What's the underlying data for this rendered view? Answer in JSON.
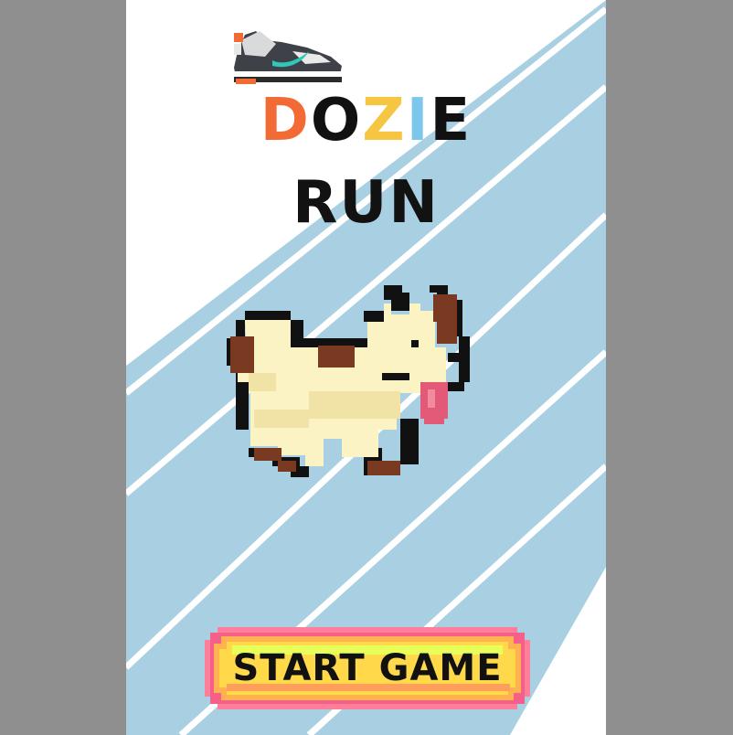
{
  "title": {
    "line1_letters": [
      {
        "char": "D",
        "color": "#f26b35"
      },
      {
        "char": "O",
        "color": "#111111"
      },
      {
        "char": "Z",
        "color": "#f6c542"
      },
      {
        "char": "I",
        "color": "#7cc8ec"
      },
      {
        "char": "E",
        "color": "#111111"
      }
    ],
    "line2": "RUN"
  },
  "start_button": {
    "label": "START GAME",
    "colors": {
      "outer": "#ff6a8a",
      "inner": "#ffd94a",
      "glow": "#d8ff4a"
    }
  },
  "colors": {
    "background": "#8f8f8f",
    "screen": "#ffffff",
    "track": "#a8d0e2",
    "lane": "#ffffff"
  },
  "icons": {
    "shoe": "sneaker-icon",
    "mascot": "pixel-dog-character"
  }
}
